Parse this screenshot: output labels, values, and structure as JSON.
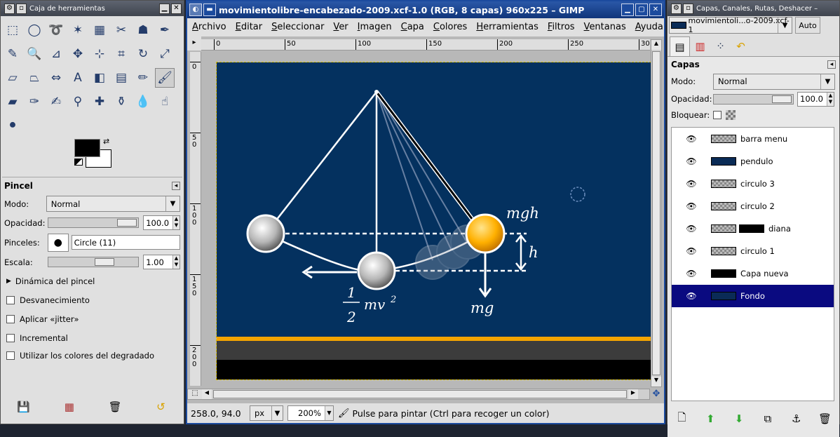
{
  "toolbox": {
    "title": "Caja de herramientas",
    "tools": [
      {
        "icon": "rect-select-icon",
        "g": "⬚"
      },
      {
        "icon": "ellipse-select-icon",
        "g": "◯"
      },
      {
        "icon": "lasso-icon",
        "g": "➰"
      },
      {
        "icon": "fuzzy-select-icon",
        "g": "✶"
      },
      {
        "icon": "color-select-icon",
        "g": "▦"
      },
      {
        "icon": "scissors-icon",
        "g": "✂"
      },
      {
        "icon": "foreground-select-icon",
        "g": "☗"
      },
      {
        "icon": "paths-icon",
        "g": "✒"
      },
      {
        "icon": "color-picker-icon",
        "g": "✎"
      },
      {
        "icon": "zoom-icon",
        "g": "🔍"
      },
      {
        "icon": "measure-icon",
        "g": "⊿"
      },
      {
        "icon": "move-icon",
        "g": "✥"
      },
      {
        "icon": "align-icon",
        "g": "⊹"
      },
      {
        "icon": "crop-icon",
        "g": "⌗"
      },
      {
        "icon": "rotate-icon",
        "g": "↻"
      },
      {
        "icon": "scale-icon",
        "g": "⤢"
      },
      {
        "icon": "shear-icon",
        "g": "▱"
      },
      {
        "icon": "perspective-icon",
        "g": "⏢"
      },
      {
        "icon": "flip-icon",
        "g": "⇔"
      },
      {
        "icon": "text-icon",
        "g": "A"
      },
      {
        "icon": "bucket-fill-icon",
        "g": "◧"
      },
      {
        "icon": "blend-icon",
        "g": "▤"
      },
      {
        "icon": "pencil-icon",
        "g": "✏"
      },
      {
        "icon": "paintbrush-icon",
        "g": "🖌"
      },
      {
        "icon": "eraser-icon",
        "g": "▰"
      },
      {
        "icon": "airbrush-icon",
        "g": "✑"
      },
      {
        "icon": "ink-icon",
        "g": "✍"
      },
      {
        "icon": "clone-icon",
        "g": "⚲"
      },
      {
        "icon": "heal-icon",
        "g": "✚"
      },
      {
        "icon": "perspective-clone-icon",
        "g": "⚱"
      },
      {
        "icon": "blur-icon",
        "g": "💧"
      },
      {
        "icon": "smudge-icon",
        "g": "☝"
      },
      {
        "icon": "dodge-burn-icon",
        "g": "⚫"
      }
    ],
    "options_title": "Pincel",
    "mode_label": "Modo:",
    "mode_value": "Normal",
    "opacity_label": "Opacidad:",
    "opacity_value": "100.0",
    "brushes_label": "Pinceles:",
    "brush_name": "Circle (11)",
    "scale_label": "Escala:",
    "scale_value": "1.00",
    "dynamics_label": "Dinámica del pincel",
    "checks": [
      "Desvanecimiento",
      "Aplicar «jitter»",
      "Incremental",
      "Utilizar los colores del degradado"
    ]
  },
  "image": {
    "title": "movimientolibre-encabezado-2009.xcf-1.0 (RGB, 8 capas) 960x225 – GIMP",
    "menus": [
      "Archivo",
      "Editar",
      "Seleccionar",
      "Ver",
      "Imagen",
      "Capa",
      "Colores",
      "Herramientas",
      "Filtros",
      "Ventanas",
      "Ayuda"
    ],
    "hruler": [
      "0",
      "50",
      "100",
      "150",
      "200",
      "250",
      "30"
    ],
    "vruler": [
      "0",
      "50",
      "100",
      "150",
      "200"
    ],
    "coords": "258.0, 94.0",
    "unit": "px",
    "zoom": "200%",
    "status": "Pulse para pintar (Ctrl para recoger un color)",
    "canvas": {
      "mgh": "mgh",
      "h": "h",
      "mg": "mg",
      "frac_num": "1",
      "frac_den": "2",
      "mv": "mv",
      "sq": "2"
    }
  },
  "layers": {
    "title": "Capas, Canales, Rutas, Deshacer –",
    "image_select": "movimientoli...o-2009.xcf-1",
    "auto": "Auto",
    "header": "Capas",
    "mode_label": "Modo:",
    "mode_value": "Normal",
    "opacity_label": "Opacidad:",
    "opacity_value": "100.0",
    "lock_label": "Bloquear:",
    "items": [
      {
        "name": "barra menu",
        "thumb": "chk"
      },
      {
        "name": "pendulo",
        "thumb": "dk"
      },
      {
        "name": "circulo 3",
        "thumb": "chk"
      },
      {
        "name": "circulo 2",
        "thumb": "chk"
      },
      {
        "name": "diana",
        "thumb": "chk"
      },
      {
        "name": "circulo 1",
        "thumb": "chk"
      },
      {
        "name": "Capa nueva",
        "thumb": "blk"
      },
      {
        "name": "Fondo",
        "thumb": "dk"
      }
    ],
    "selected": 7
  }
}
